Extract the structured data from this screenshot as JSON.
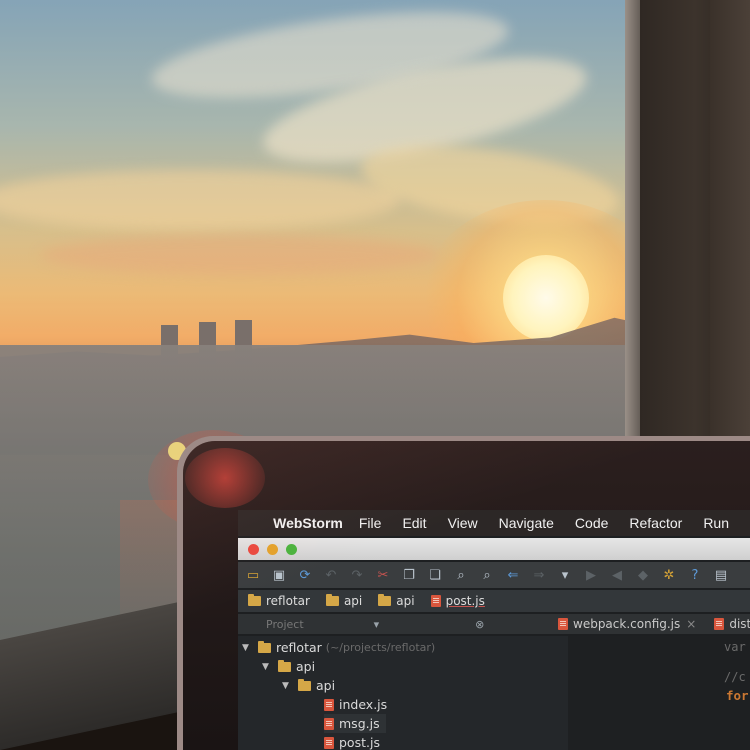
{
  "menubar": {
    "apple": "",
    "app": "WebStorm",
    "items": [
      "File",
      "Edit",
      "View",
      "Navigate",
      "Code",
      "Refactor",
      "Run"
    ]
  },
  "navbar": {
    "crumbs": [
      "reflotar",
      "api",
      "api",
      "post.js"
    ]
  },
  "project_panel": {
    "label": "Project"
  },
  "editor_tabs": [
    {
      "name": "webpack.config.js",
      "close": "×"
    },
    {
      "name": "dista"
    }
  ],
  "tree": {
    "root": {
      "name": "reflotar",
      "path": "(~/projects/reflotar)"
    },
    "folder1": "api",
    "folder2": "api",
    "files": [
      "index.js",
      "msg.js",
      "post.js"
    ]
  },
  "editor": {
    "line1": "var",
    "line2": "//c",
    "line3": "for"
  },
  "colors": {
    "folder": "#d5a747",
    "jsfile": "#d9563d",
    "keyword": "#cc7832",
    "editor_bg": "#1e2022"
  }
}
